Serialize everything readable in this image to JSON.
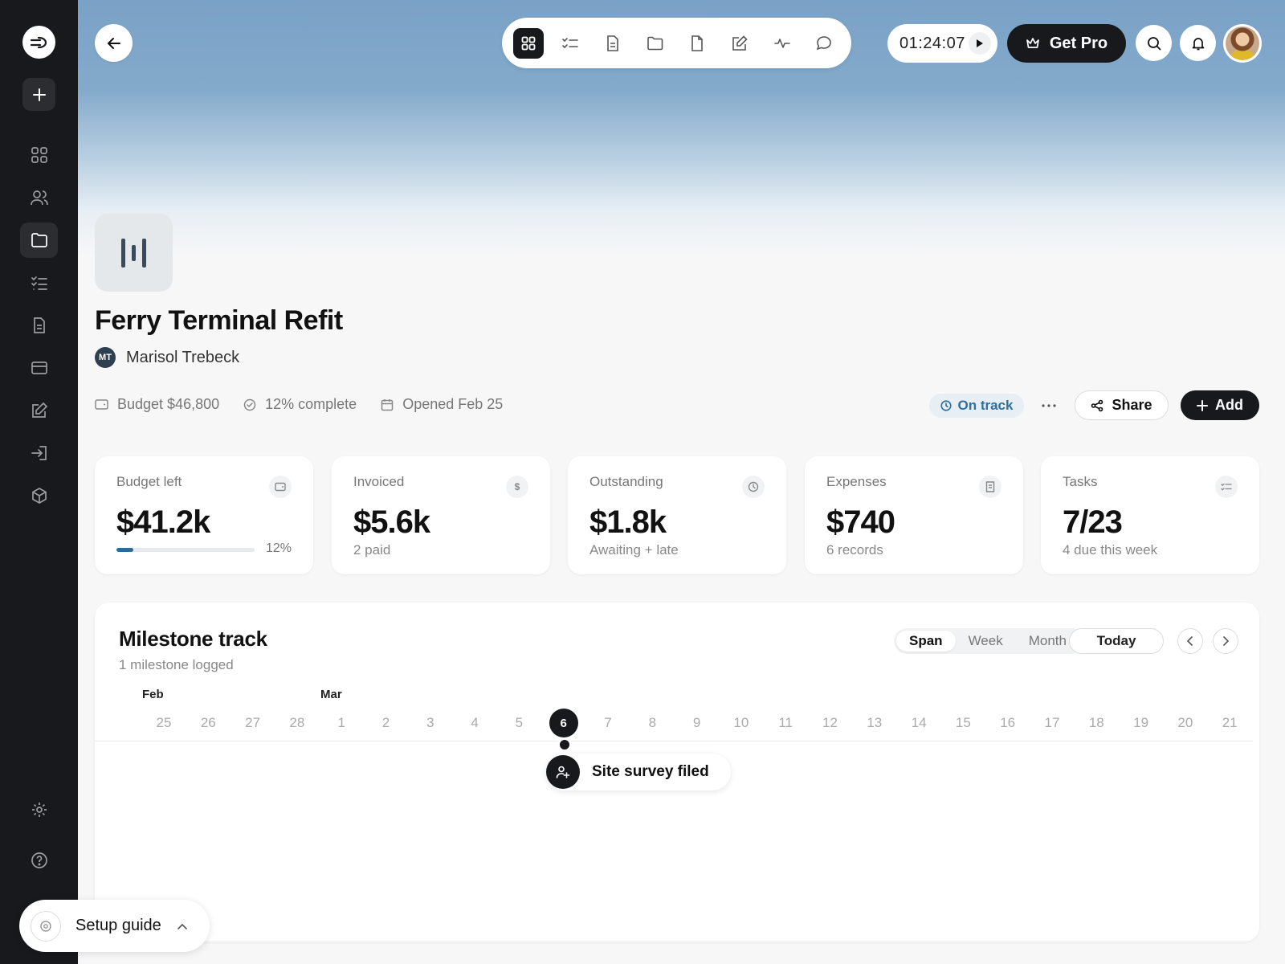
{
  "sidebar": {
    "items": [
      {
        "icon": "dashboard-grid-icon",
        "active": false
      },
      {
        "icon": "users-icon",
        "active": false
      },
      {
        "icon": "folder-icon",
        "active": true
      },
      {
        "icon": "checklist-icon",
        "active": false
      },
      {
        "icon": "document-icon",
        "active": false
      },
      {
        "icon": "card-icon",
        "active": false
      },
      {
        "icon": "edit-icon",
        "active": false
      },
      {
        "icon": "login-icon",
        "active": false
      },
      {
        "icon": "package-icon",
        "active": false
      }
    ],
    "bottom": [
      {
        "icon": "settings-icon"
      },
      {
        "icon": "help-icon"
      }
    ]
  },
  "toolbar": {
    "items": [
      "grid-icon",
      "checklist-icon",
      "document-icon",
      "folder-icon",
      "file-icon",
      "edit-icon",
      "activity-icon",
      "chat-icon"
    ]
  },
  "timer": {
    "value": "01:24:07"
  },
  "get_pro": {
    "label": "Get Pro"
  },
  "project": {
    "title": "Ferry Terminal Refit",
    "owner_initials": "MT",
    "owner_name": "Marisol Trebeck",
    "budget": "Budget $46,800",
    "complete": "12% complete",
    "opened": "Opened Feb 25",
    "status": "On track",
    "share_label": "Share",
    "add_label": "Add"
  },
  "stats": {
    "budget_left": {
      "label": "Budget left",
      "value": "$41.2k",
      "progress": 0.12,
      "progress_label": "12%"
    },
    "invoiced": {
      "label": "Invoiced",
      "value": "$5.6k",
      "sub": "2 paid"
    },
    "outstanding": {
      "label": "Outstanding",
      "value": "$1.8k",
      "sub": "Awaiting + late"
    },
    "expenses": {
      "label": "Expenses",
      "value": "$740",
      "sub": "6 records"
    },
    "tasks": {
      "label": "Tasks",
      "value": "7/23",
      "sub": "4 due this week"
    }
  },
  "milestones": {
    "title": "Milestone track",
    "subtitle": "1 milestone logged",
    "views": [
      "Span",
      "Week",
      "Month"
    ],
    "active_view": "Span",
    "today_label": "Today",
    "months": [
      "Feb",
      "Mar"
    ],
    "days": [
      "25",
      "26",
      "27",
      "28",
      "1",
      "2",
      "3",
      "4",
      "5",
      "6",
      "7",
      "8",
      "9",
      "10",
      "11",
      "12",
      "13",
      "14",
      "15",
      "16",
      "17",
      "18",
      "19",
      "20",
      "21"
    ],
    "today_index": 9,
    "items": [
      {
        "label": "Site survey filed",
        "day_index": 9
      }
    ]
  },
  "setup_guide": {
    "label": "Setup guide"
  },
  "colors": {
    "accent": "#2e6a93",
    "dark": "#17191c",
    "status_bg": "#e7eff5"
  }
}
